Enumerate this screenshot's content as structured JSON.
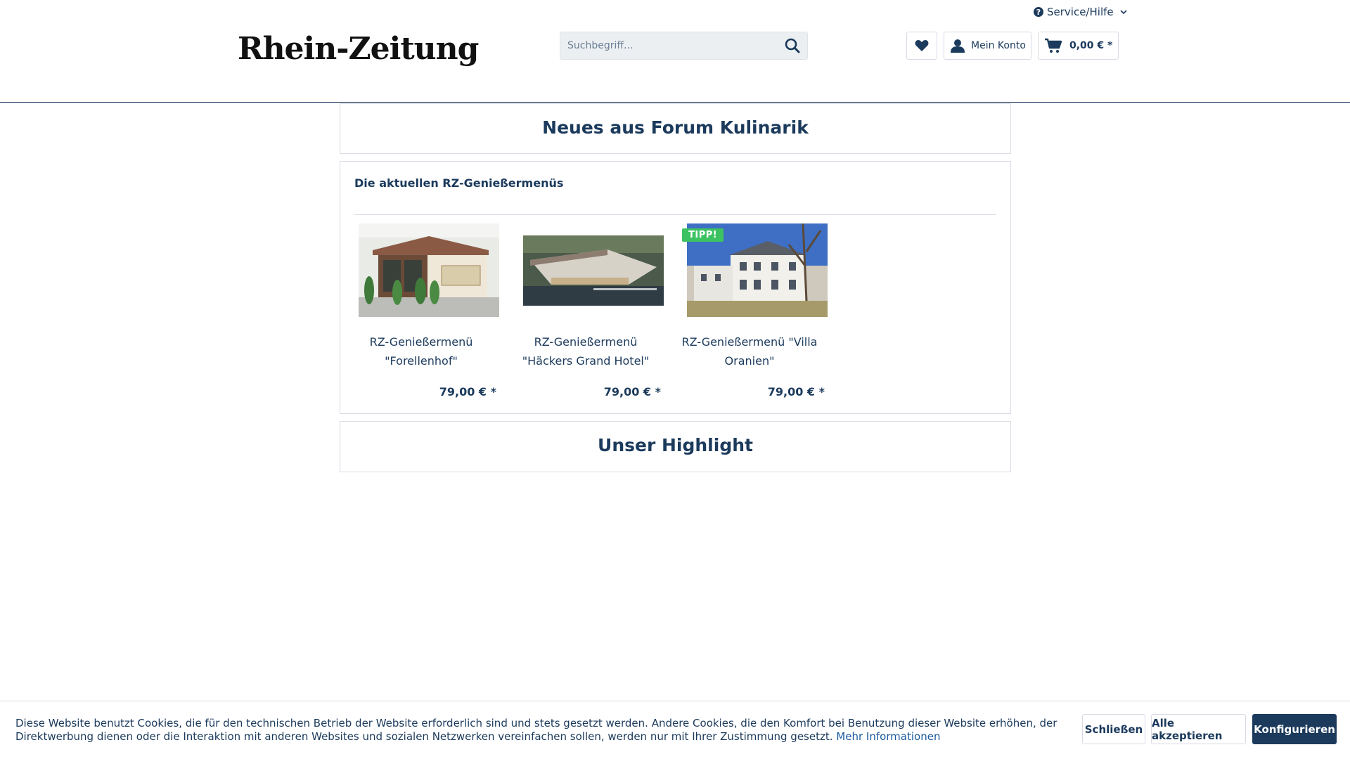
{
  "header": {
    "service_label": "Service/Hilfe",
    "logo_text": "Rhein-Zeitung",
    "search": {
      "placeholder": "Suchbegriff..."
    },
    "account_label": "Mein Konto",
    "cart_total": "0,00 € *"
  },
  "panels": {
    "news_title": "Neues aus Forum Kulinarik",
    "menus_title": "Die aktuellen RZ-Genießermenüs",
    "highlight_title": "Unser Highlight"
  },
  "products": [
    {
      "name": "RZ-Genießermenü \"Forellenhof\"",
      "price": "79,00 € *",
      "badge": ""
    },
    {
      "name": "RZ-Genießermenü \"Häckers Grand Hotel\"",
      "price": "79,00 € *",
      "badge": ""
    },
    {
      "name": "RZ-Genießermenü \"Villa Oranien\"",
      "price": "79,00 € *",
      "badge": "TIPP!"
    }
  ],
  "cookie": {
    "text": "Diese Website benutzt Cookies, die für den technischen Betrieb der Website erforderlich sind und stets gesetzt werden. Andere Cookies, die den Komfort bei Benutzung dieser Website erhöhen, der Direktwerbung dienen oder die Interaktion mit anderen Websites und sozialen Netzwerken vereinfachen sollen, werden nur mit Ihrer Zustimmung gesetzt.",
    "more_link": "Mehr Informationen",
    "close_label": "Schließen",
    "accept_label": "Alle akzeptieren",
    "configure_label": "Konfigurieren"
  },
  "colors": {
    "primary": "#1b3a5c",
    "badge_green": "#3cc261",
    "border": "#dadae5"
  }
}
